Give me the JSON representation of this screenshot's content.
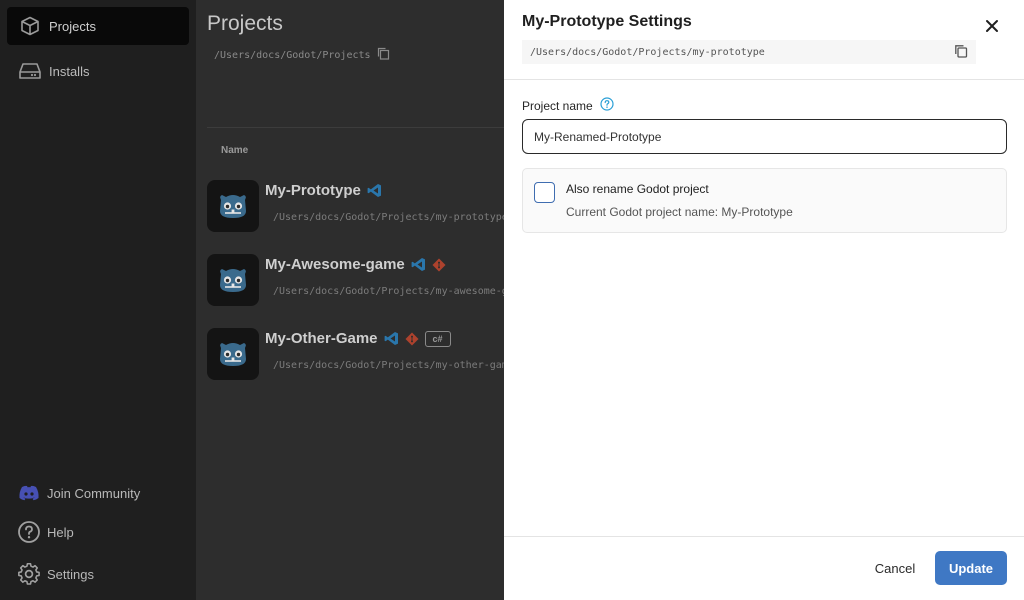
{
  "sidebar": {
    "items": [
      {
        "label": "Projects",
        "icon": "box-icon",
        "active": true
      },
      {
        "label": "Installs",
        "icon": "drive-icon",
        "active": false
      }
    ],
    "footer": [
      {
        "label": "Join Community",
        "icon": "discord-icon"
      },
      {
        "label": "Help",
        "icon": "help-icon"
      },
      {
        "label": "Settings",
        "icon": "gear-icon"
      }
    ]
  },
  "main": {
    "title": "Projects",
    "path": "/Users/docs/Godot/Projects",
    "columns": {
      "name": "Name"
    },
    "projects": [
      {
        "name": "My-Prototype",
        "path": "/Users/docs/Godot/Projects/my-prototype",
        "editor": "vscode-icon",
        "git": false,
        "csharp": false
      },
      {
        "name": "My-Awesome-game",
        "path": "/Users/docs/Godot/Projects/my-awesome-game",
        "editor": "vscode-icon",
        "git": true,
        "csharp": false
      },
      {
        "name": "My-Other-Game",
        "path": "/Users/docs/Godot/Projects/my-other-game",
        "editor": "vscode-icon",
        "git": true,
        "csharp": true,
        "badge": "c#"
      }
    ]
  },
  "drawer": {
    "title": "My-Prototype Settings",
    "path": "/Users/docs/Godot/Projects/my-prototype",
    "project_name_label": "Project name",
    "project_name_value": "My-Renamed-Prototype",
    "rename_option": {
      "label": "Also rename Godot project",
      "detail": "Current Godot project name: My-Prototype",
      "checked": false
    },
    "cancel_label": "Cancel",
    "update_label": "Update"
  },
  "colors": {
    "accent": "#3f78c4",
    "help_icon": "#2a9fd6",
    "vscode": "#2a8fd6",
    "git": "#d8492d",
    "overlay": "#2d2d2d"
  }
}
